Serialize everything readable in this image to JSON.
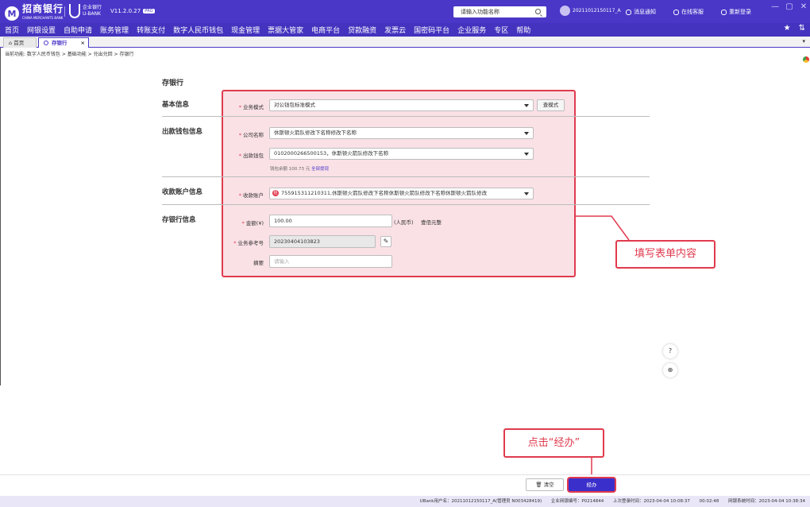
{
  "header": {
    "bank_name": "招商银行",
    "bank_name_en": "CHINA MERCHANTS BANK",
    "ubank_label": "企业银行",
    "ubank_sub": "U-BANK",
    "version": "V11.2.0.27",
    "version_badge": "PRO",
    "search_placeholder": "请输入功能名称",
    "user": "20211012150117_A",
    "links": [
      "消息通知",
      "在线客服",
      "重新登录"
    ],
    "window_buttons": [
      "—",
      "▢",
      "✕"
    ]
  },
  "nav": {
    "items": [
      "首页",
      "网银设置",
      "自助申请",
      "账务管理",
      "转账支付",
      "数字人民币钱包",
      "现金管理",
      "票据大管家",
      "电商平台",
      "贷款融资",
      "发票云",
      "国密码平台",
      "企业服务",
      "专区",
      "帮助"
    ],
    "right": [
      "★",
      "⇅"
    ]
  },
  "tabs": {
    "home": "首页",
    "active": "存银行",
    "close": "×",
    "more": "▾"
  },
  "breadcrumb": "当前功能:  数字人民币钱包 > 基础功能 > 兑出兑回 > 存银行",
  "form": {
    "title": "存银行",
    "sections": {
      "basic": "基本信息",
      "wallet": "出款钱包信息",
      "receive": "收款账户信息",
      "deposit": "存银行信息"
    },
    "fields": {
      "mode_label": "业务模式",
      "mode_value": "对公钱包标准模式",
      "mode_button": "查模式",
      "company_label": "公司名称",
      "company_value": "休斯顿火箭队修改下名称修改下名称",
      "wallet_label": "出款钱包",
      "wallet_value": "0102000266500153，休斯顿火箭队修改下名称",
      "balance_hint": "钱包余额 100.73 元",
      "balance_link": "全部提现",
      "account_label": "收款账户",
      "account_value": "755915311210311,休斯顿火箭队修改下名称休斯顿火箭队修改下名称休斯顿火箭队修改",
      "account_bank_glyph": "招",
      "amount_label": "金额(¥)",
      "amount_value": "100.00",
      "amount_unit": "(人民币)",
      "amount_cn": "壹佰元整",
      "ref_label": "业务参考号",
      "ref_value": "20230404103823",
      "memo_label": "摘要",
      "memo_placeholder": "请输入"
    }
  },
  "annotations": {
    "fill_form": "填写表单内容",
    "click_submit": "点击“经办”"
  },
  "float_tools": [
    "?",
    "⊕"
  ],
  "actions": {
    "clear": "清空",
    "submit": "经办"
  },
  "status": {
    "user": "UBank用户名：20211012150117_A(管理员 N003428419)",
    "company_no": "企业网银编号：P0214844",
    "last_login": "上次登录时间：2023-04-04 10:08:37",
    "duration": "00:02:48",
    "system_time": "网银系统时间：2023-04-04 10:38:34"
  },
  "colors": {
    "brand": "#4a37c8",
    "highlight": "#e03b4e"
  }
}
